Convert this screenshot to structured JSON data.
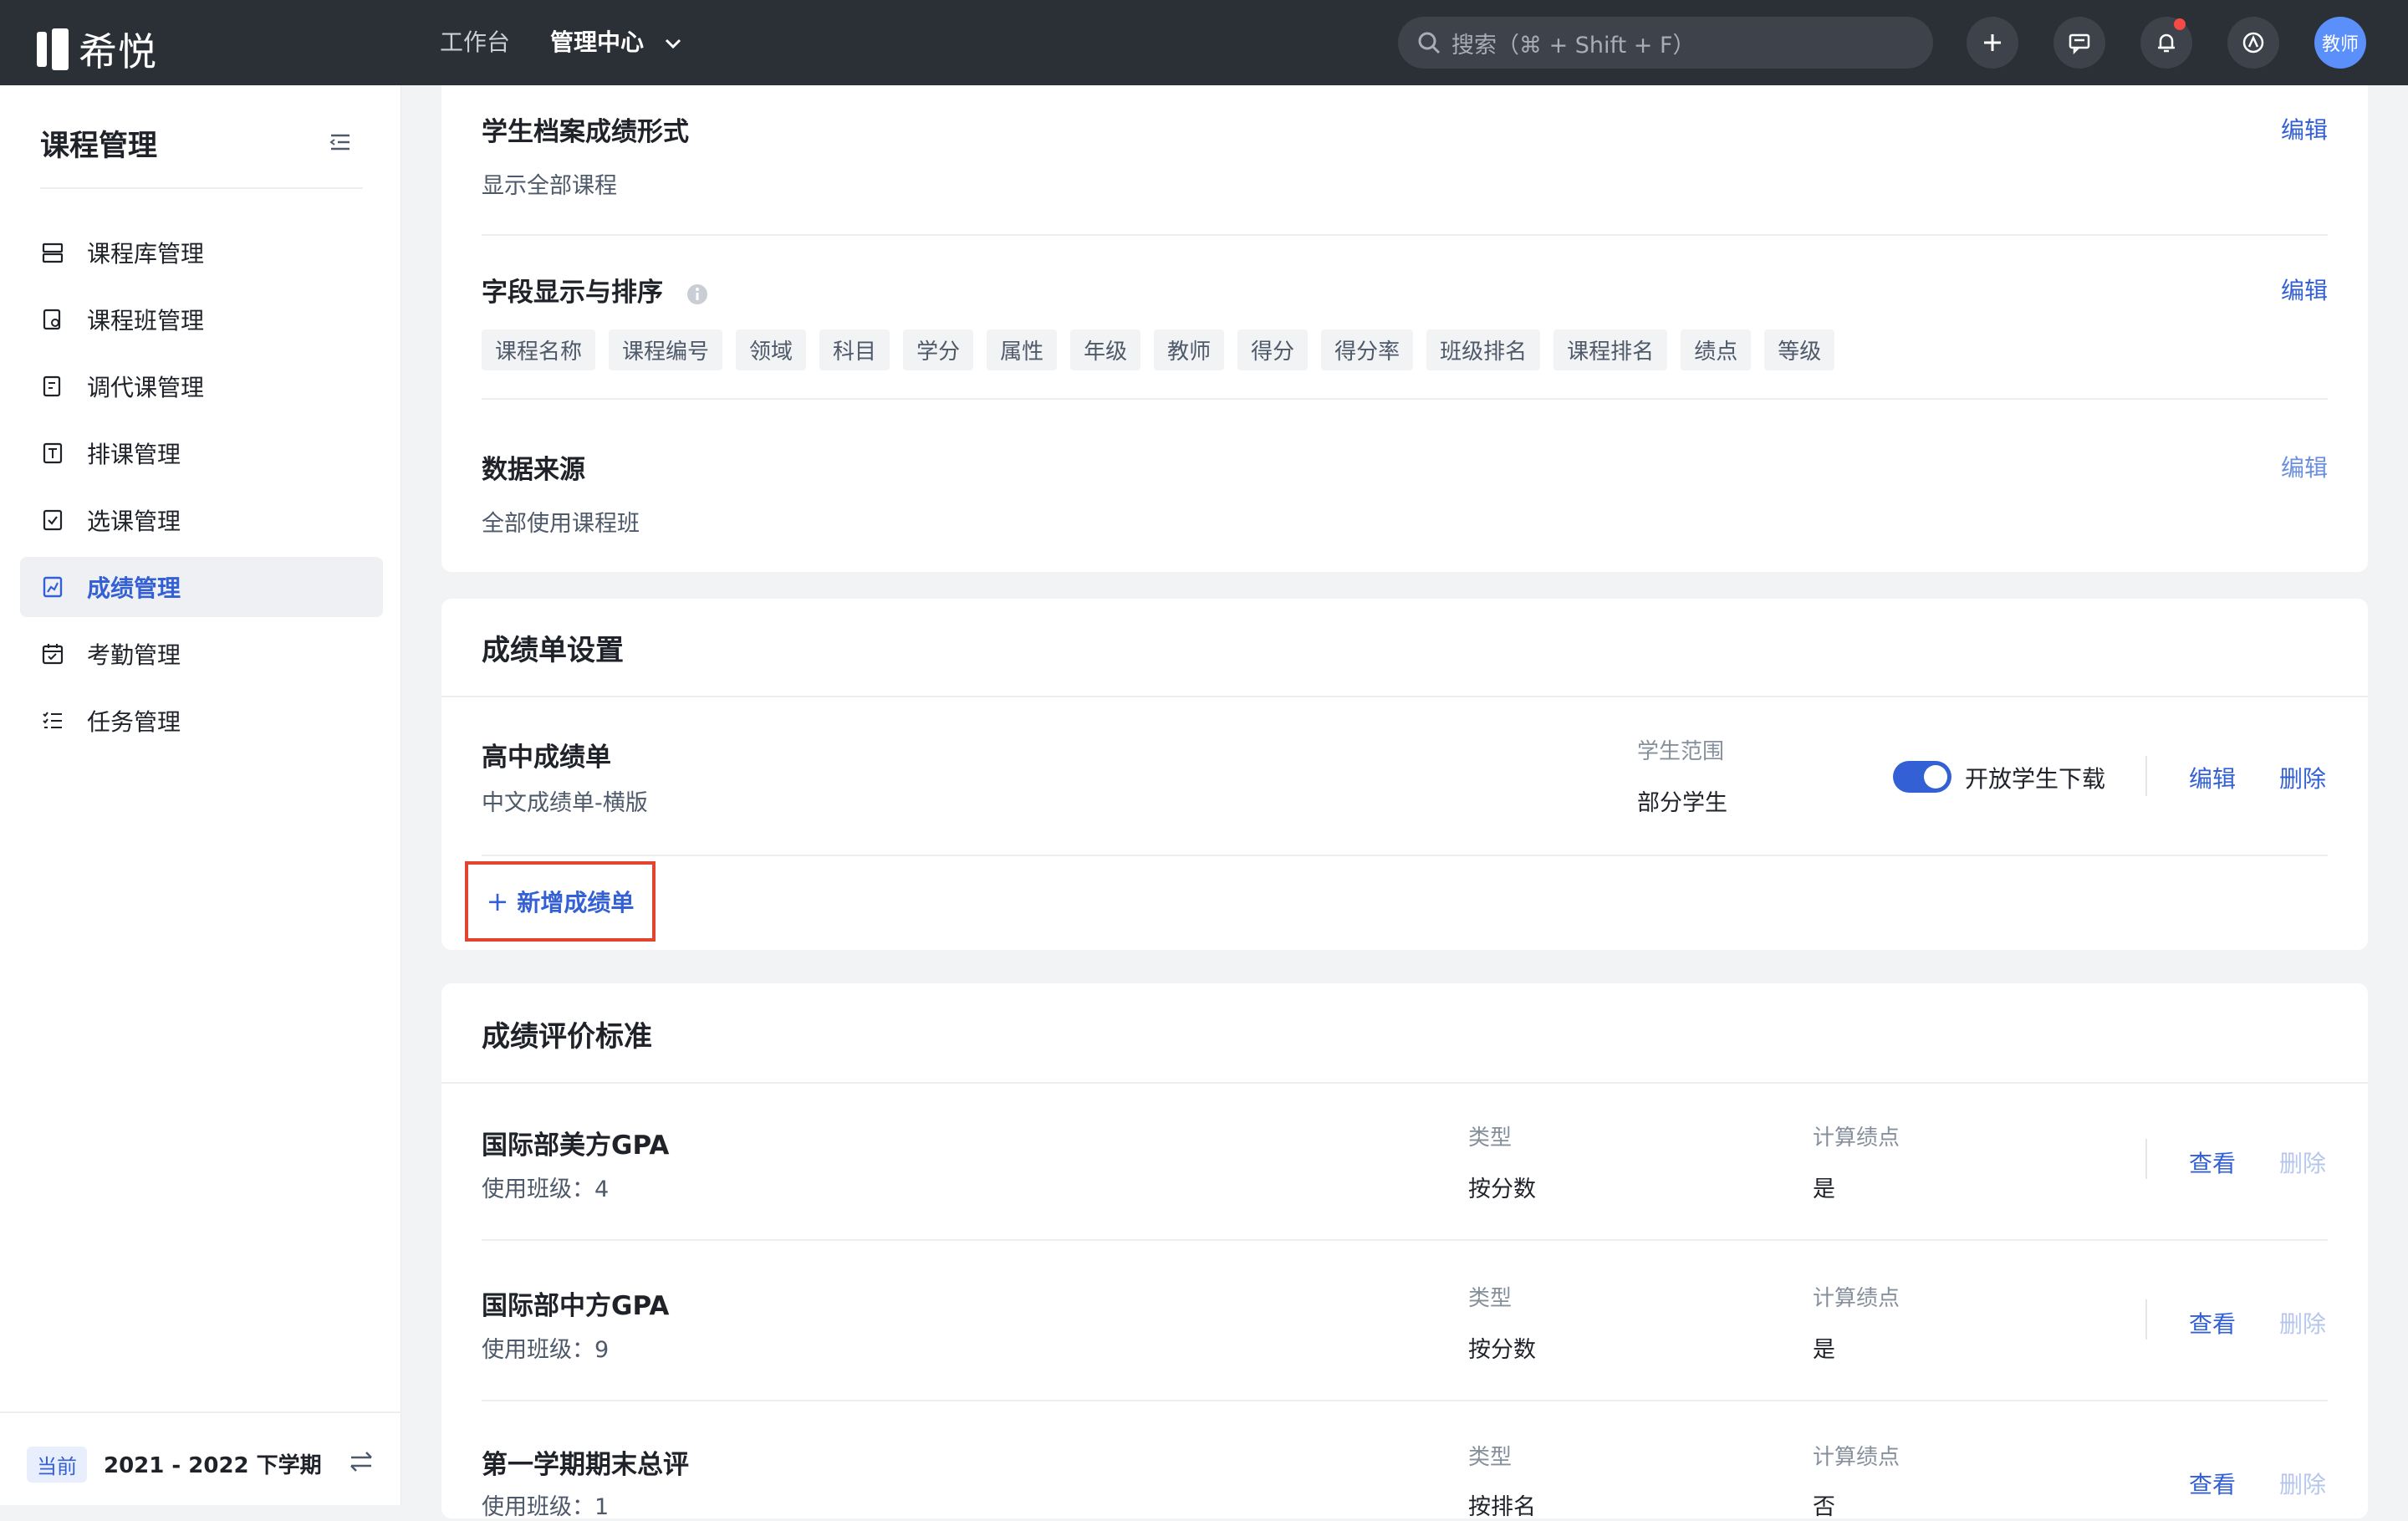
{
  "app": {
    "logo_text": "希悦"
  },
  "topnav": {
    "workbench": "工作台",
    "admin_center": "管理中心",
    "search_placeholder": "搜索（⌘ + Shift + F）",
    "avatar_label": "教师"
  },
  "sidebar": {
    "title": "课程管理",
    "items": [
      {
        "label": "课程库管理",
        "icon": "course-library-icon"
      },
      {
        "label": "课程班管理",
        "icon": "course-class-icon"
      },
      {
        "label": "调代课管理",
        "icon": "substitute-icon"
      },
      {
        "label": "排课管理",
        "icon": "schedule-icon"
      },
      {
        "label": "选课管理",
        "icon": "selection-icon"
      },
      {
        "label": "成绩管理",
        "icon": "grades-icon",
        "active": true
      },
      {
        "label": "考勤管理",
        "icon": "attendance-icon"
      },
      {
        "label": "任务管理",
        "icon": "tasks-icon"
      }
    ],
    "footer": {
      "badge": "当前",
      "term": "2021 - 2022 下学期"
    }
  },
  "archive_card": {
    "sections": [
      {
        "title": "学生档案成绩形式",
        "value": "显示全部课程",
        "edit": "编辑"
      },
      {
        "title": "字段显示与排序",
        "edit": "编辑",
        "tags": [
          "课程名称",
          "课程编号",
          "领域",
          "科目",
          "学分",
          "属性",
          "年级",
          "教师",
          "得分",
          "得分率",
          "班级排名",
          "课程排名",
          "绩点",
          "等级"
        ]
      },
      {
        "title": "数据来源",
        "value": "全部使用课程班",
        "edit": "编辑"
      }
    ]
  },
  "report_card": {
    "title": "成绩单设置",
    "item": {
      "name": "高中成绩单",
      "template": "中文成绩单-横版",
      "scope_label": "学生范围",
      "scope_value": "部分学生",
      "toggle_label": "开放学生下载",
      "toggle_on": true,
      "edit": "编辑",
      "delete": "删除"
    },
    "add_label": "新增成绩单"
  },
  "standards_card": {
    "title": "成绩评价标准",
    "type_label": "类型",
    "gpa_label": "计算绩点",
    "view": "查看",
    "delete": "删除",
    "rows": [
      {
        "name": "国际部美方GPA",
        "usage": "使用班级：4",
        "type": "按分数",
        "gpa": "是"
      },
      {
        "name": "国际部中方GPA",
        "usage": "使用班级：9",
        "type": "按分数",
        "gpa": "是"
      },
      {
        "name": "第一学期期末总评",
        "usage": "使用班级：1",
        "type": "按排名",
        "gpa": "否"
      }
    ]
  },
  "colors": {
    "accent": "#3460d6",
    "topbar": "#2b2f36",
    "highlight_border": "#e2442f"
  }
}
